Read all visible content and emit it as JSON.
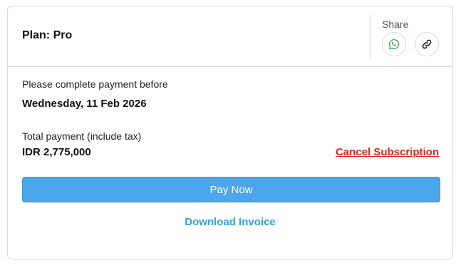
{
  "header": {
    "plan_title": "Plan: Pro",
    "share_label": "Share",
    "share_icons": [
      "whatsapp-icon",
      "link-icon"
    ]
  },
  "payment": {
    "deadline_label": "Please complete payment before",
    "deadline_value": "Wednesday, 11 Feb 2026",
    "total_label": "Total payment (include tax)",
    "total_value": "IDR 2,775,000"
  },
  "actions": {
    "cancel_label": "Cancel Subscription",
    "pay_label": "Pay Now",
    "download_label": "Download Invoice"
  },
  "colors": {
    "primary": "#4ba6ec",
    "link": "#3a9ee3",
    "danger": "#e0281c",
    "whatsapp": "#25a244",
    "border": "#d9d9d9"
  }
}
